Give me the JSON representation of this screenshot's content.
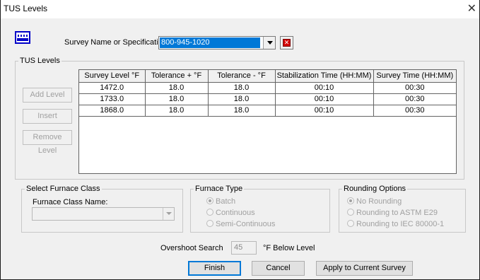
{
  "window": {
    "title": "TUS Levels",
    "close_glyph": "✕"
  },
  "survey": {
    "label": "Survey Name or Specification:",
    "value": "800-945-1020",
    "clear_glyph": "✕"
  },
  "tus_levels": {
    "legend": "TUS Levels",
    "buttons": {
      "add": "Add Level",
      "insert": "Insert",
      "remove": "Remove Level"
    },
    "columns": [
      "Survey Level °F",
      "Tolerance + °F",
      "Tolerance - °F",
      "Stabilization Time (HH:MM)",
      "Survey Time (HH:MM)"
    ],
    "rows": [
      [
        "1472.0",
        "18.0",
        "18.0",
        "00:10",
        "00:30"
      ],
      [
        "1733.0",
        "18.0",
        "18.0",
        "00:10",
        "00:30"
      ],
      [
        "1868.0",
        "18.0",
        "18.0",
        "00:10",
        "00:30"
      ]
    ]
  },
  "furnace_class": {
    "legend": "Select Furnace Class",
    "field_label": "Furnace Class Name:",
    "value": ""
  },
  "furnace_type": {
    "legend": "Furnace Type",
    "options": [
      "Batch",
      "Continuous",
      "Semi-Continuous"
    ],
    "selected": "Batch"
  },
  "rounding": {
    "legend": "Rounding Options",
    "options": [
      "No Rounding",
      "Rounding to ASTM E29",
      "Rounding to IEC 80000-1"
    ],
    "selected": "No Rounding"
  },
  "overshoot": {
    "label": "Overshoot Search",
    "value": "45",
    "unit": "°F Below Level"
  },
  "footer": {
    "finish": "Finish",
    "cancel": "Cancel",
    "apply": "Apply to Current Survey"
  }
}
